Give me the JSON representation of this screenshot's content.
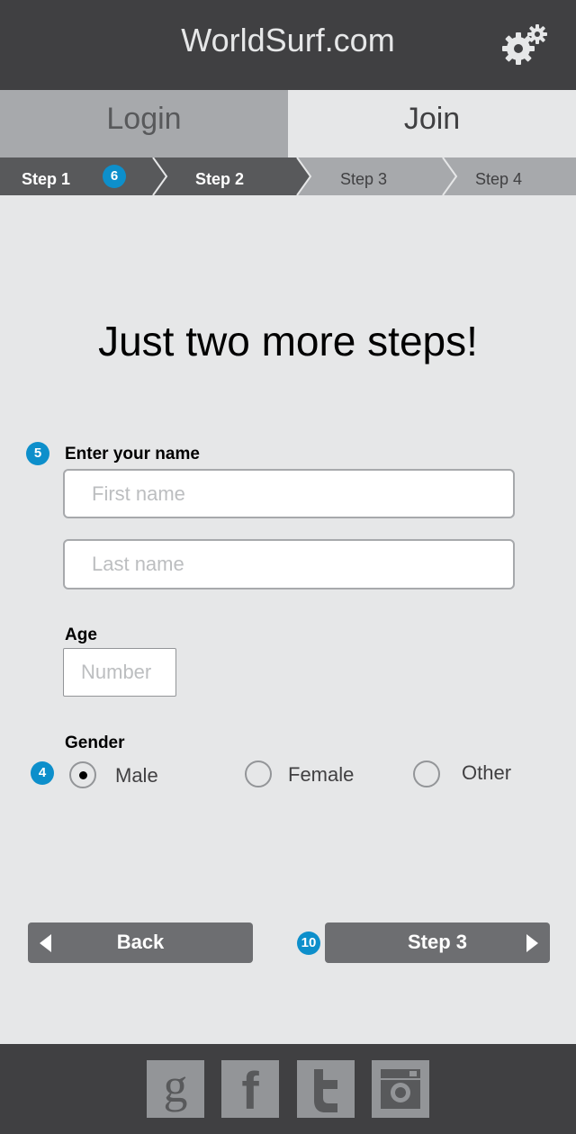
{
  "header": {
    "title": "WorldSurf.com",
    "settings_icon": "gears-icon"
  },
  "tabs": [
    {
      "label": "Login",
      "active": false
    },
    {
      "label": "Join",
      "active": true
    }
  ],
  "steps": [
    {
      "label": "Step 1",
      "state": "done"
    },
    {
      "label": "Step 2",
      "state": "current"
    },
    {
      "label": "Step 3",
      "state": "upcoming"
    },
    {
      "label": "Step 4",
      "state": "upcoming"
    }
  ],
  "annotations": {
    "steps_badge": "6",
    "name_badge": "5",
    "gender_badge": "4",
    "next_badge": "10"
  },
  "main": {
    "heading": "Just two more steps!",
    "name_label": "Enter your name",
    "first_name": {
      "value": "",
      "placeholder": "First name"
    },
    "last_name": {
      "value": "",
      "placeholder": "Last name"
    },
    "age_label": "Age",
    "age": {
      "value": "",
      "placeholder": "Number"
    },
    "gender_label": "Gender",
    "gender_options": [
      {
        "label": "Male",
        "selected": true
      },
      {
        "label": "Female",
        "selected": false
      },
      {
        "label": "Other",
        "selected": false
      }
    ]
  },
  "nav": {
    "back_label": "Back",
    "next_label": "Step 3"
  },
  "footer": {
    "social_icons": [
      "google-icon",
      "facebook-icon",
      "twitter-icon",
      "instagram-icon"
    ],
    "google_glyph": "g",
    "facebook_glyph": "f"
  },
  "colors": {
    "dark": "#404042",
    "badge": "#0d8fcb",
    "button": "#6d6e71",
    "background": "#e6e7e8"
  }
}
